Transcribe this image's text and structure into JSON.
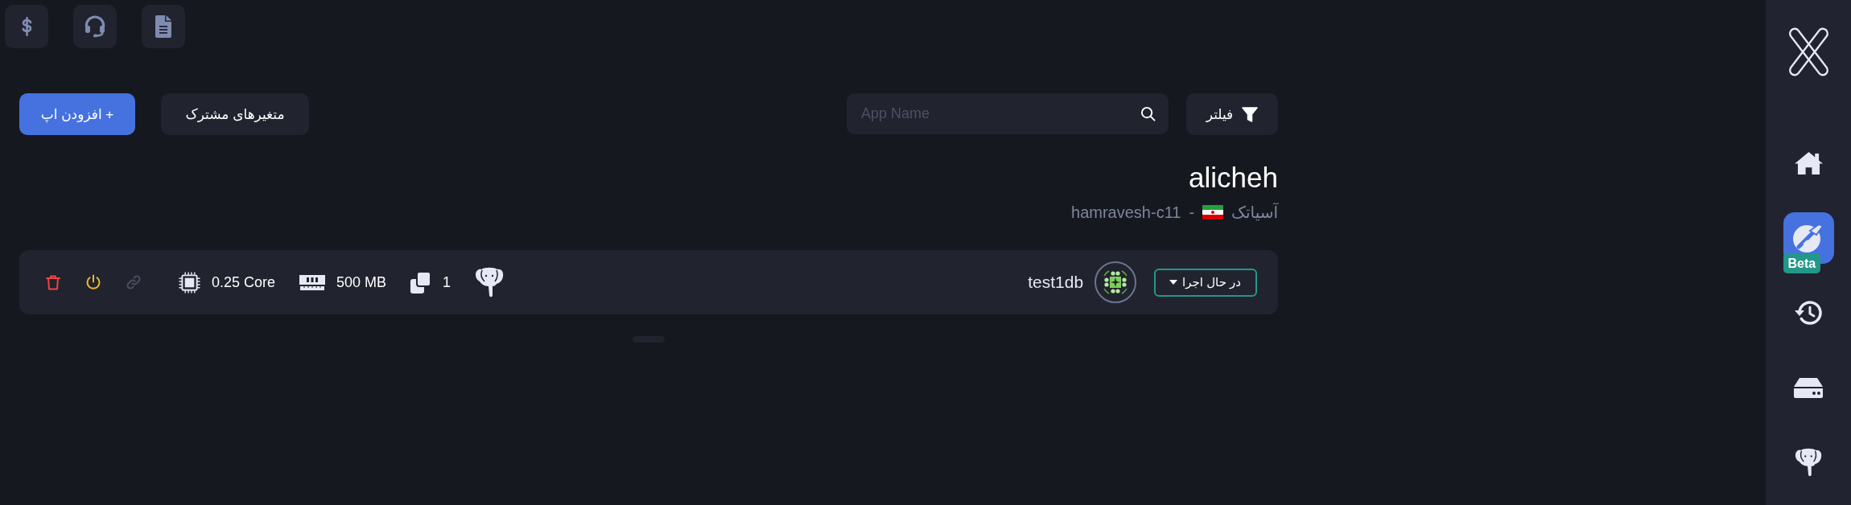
{
  "toolbar": {
    "add_button": "+ افزودن اپ",
    "shared_variables_button": "متغیرهای مشترک",
    "search": {
      "placeholder": "App Name"
    },
    "filter_button": "فیلتر"
  },
  "project": {
    "title": "alicheh",
    "region": "آسیاتک",
    "separator": "-",
    "cluster": "hamravesh-c11"
  },
  "apps": [
    {
      "name": "test1db",
      "status": "در حال اجرا",
      "replicas": "1",
      "memory": "500 MB",
      "cpu": "0.25 Core",
      "actions": [
        {
          "kind": "delete",
          "disabled": false
        },
        {
          "kind": "power",
          "disabled": false
        },
        {
          "kind": "link",
          "disabled": true
        }
      ]
    }
  ],
  "sidebar": {
    "items": [
      {
        "kind": "home",
        "selected": false
      },
      {
        "kind": "apps",
        "selected": true,
        "badge": "Beta"
      },
      {
        "kind": "history",
        "selected": false
      },
      {
        "kind": "storage",
        "selected": false
      },
      {
        "kind": "database",
        "selected": false
      }
    ]
  }
}
